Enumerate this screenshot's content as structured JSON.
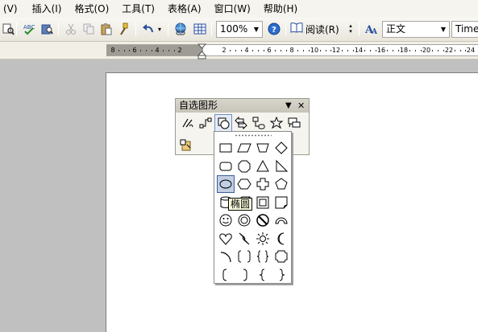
{
  "menu": {
    "items": [
      {
        "label": "(V)"
      },
      {
        "label": "插入(I)"
      },
      {
        "label": "格式(O)"
      },
      {
        "label": "工具(T)"
      },
      {
        "label": "表格(A)"
      },
      {
        "label": "窗口(W)"
      },
      {
        "label": "帮助(H)"
      }
    ]
  },
  "toolbar": {
    "zoom_value": "100%",
    "read_label": "阅读(R)",
    "style_value": "正文",
    "font_value": "Times",
    "icons": [
      "print-preview-icon",
      "spelling-icon",
      "research-icon",
      "cut-icon",
      "copy-icon",
      "paste-icon",
      "format-painter-icon",
      "undo-icon",
      "hyperlink-icon",
      "table-icon",
      "help-icon",
      "read-icon",
      "styles-icon"
    ]
  },
  "ruler": {
    "ticks": [
      "8",
      "6",
      "4",
      "2",
      "2",
      "4",
      "6",
      "8",
      "10",
      "12",
      "14",
      "16",
      "18",
      "20",
      "22",
      "24"
    ]
  },
  "autoshapes_panel": {
    "title": "自选图形",
    "dropdown_glyph": "▼",
    "close_glyph": "✕",
    "categories": [
      "lines-icon",
      "connectors-icon",
      "basic-shapes-icon",
      "block-arrows-icon",
      "flowchart-icon",
      "stars-banners-icon",
      "callouts-icon",
      "more-autoshapes-icon"
    ]
  },
  "basic_shapes": {
    "tooltip": "椭圆",
    "selected": "oval",
    "shapes": [
      "rectangle",
      "parallelogram",
      "trapezoid",
      "diamond",
      "rounded-rectangle",
      "octagon",
      "isosceles-triangle",
      "right-triangle",
      "oval",
      "hexagon",
      "cross",
      "pentagon",
      "can",
      "cube",
      "bevel",
      "folded-corner",
      "smiley-face",
      "donut",
      "no-symbol",
      "block-arc",
      "heart",
      "lightning-bolt",
      "sun",
      "moon",
      "arc",
      "double-bracket",
      "double-brace",
      "plaque",
      "left-bracket",
      "right-bracket",
      "left-brace",
      "right-brace"
    ]
  }
}
